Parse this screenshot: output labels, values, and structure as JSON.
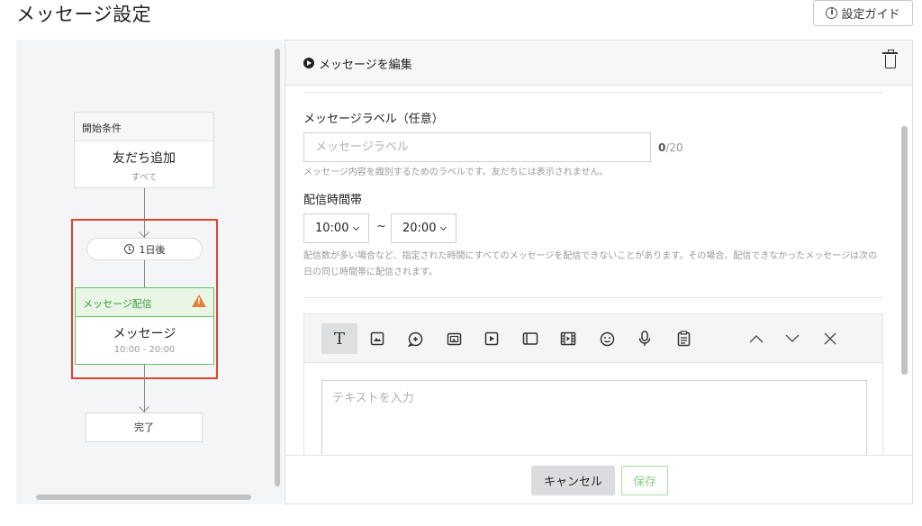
{
  "page": {
    "title": "メッセージ設定"
  },
  "header": {
    "guide_button": "設定ガイド"
  },
  "flow": {
    "start_node": {
      "header": "開始条件",
      "title": "友だち追加",
      "subtitle": "すべて"
    },
    "delay": {
      "label": "1日後"
    },
    "message_node": {
      "header": "メッセージ配信",
      "title": "メッセージ",
      "time": "10:00 - 20:00"
    },
    "end_node": {
      "label": "完了"
    }
  },
  "editor": {
    "title": "メッセージを編集",
    "label_section": {
      "title": "メッセージラベル（任意）",
      "placeholder": "メッセージラベル",
      "count": "0",
      "max": "/20",
      "help": "メッセージ内容を識別するためのラベルです。友だちには表示されません。"
    },
    "time_section": {
      "title": "配信時間帯",
      "start": "10:00",
      "separator": "~",
      "end": "20:00",
      "help": "配信数が多い場合など、指定された時間にすべてのメッセージを配信できないことがあります。その場合、配信できなかったメッセージは次の日の同じ時間帯に配信されます。"
    },
    "toolbar": {
      "tools": [
        "text-tool",
        "image-tool",
        "sticker-tool",
        "image-map-tool",
        "video-tool",
        "card-tool",
        "rich-video-tool",
        "emoji-tool",
        "voice-tool",
        "survey-tool"
      ],
      "text_glyph": "T"
    },
    "text_placeholder": "テキストを入力",
    "footer": {
      "cancel": "キャンセル",
      "save": "保存"
    }
  },
  "colors": {
    "highlight": "#e0432e",
    "green": "#67c26a",
    "warning": "#e3813a"
  }
}
